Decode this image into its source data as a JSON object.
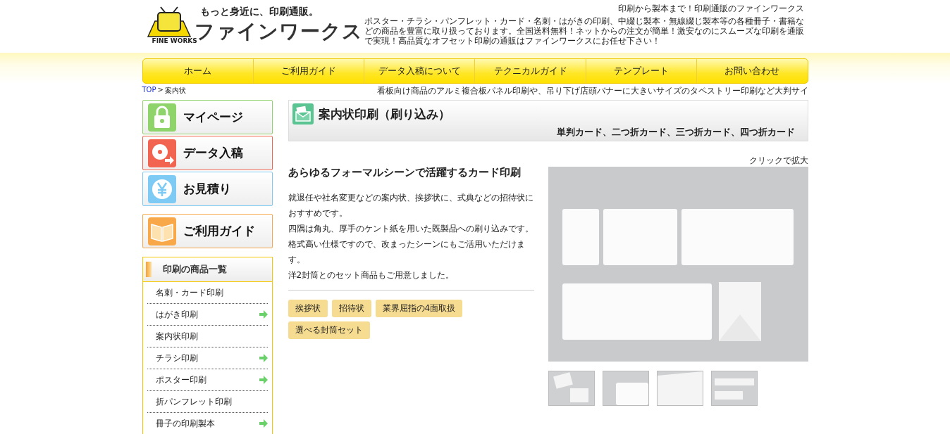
{
  "header": {
    "tagline": "もっと身近に、印刷通販。",
    "logo_text": "ファインワークス",
    "logo_badge": "FINE WORKS",
    "headline": "印刷から製本まで！印刷通販のファインワークス",
    "description": "ポスター・チラシ・パンフレット・カード・名刺・はがきの印刷、中綴じ製本・無線綴じ製本等の各種冊子・書籍などの商品を豊富に取り扱っております。全国送料無料！ネットからの注文が簡単！激安なのにスムーズな印刷を通販で実現！高品質なオフセット印刷の通販はファインワークスにお任せ下さい！"
  },
  "nav": [
    "ホーム",
    "ご利用ガイド",
    "データ入稿について",
    "テクニカルガイド",
    "テンプレート",
    "お問い合わせ"
  ],
  "breadcrumb": {
    "link": "TOP",
    "separator": ">",
    "current": "案内状"
  },
  "ticker": "看板向け商品のアルミ複合板パネル印刷や、吊り下げ店頭バナーに大きいサイズのタペストリー印刷など大判サイ",
  "sidebar": {
    "buttons": [
      {
        "label": "マイページ",
        "kind": "lock",
        "color": "#8fd46a"
      },
      {
        "label": "データ入稿",
        "kind": "disc",
        "color": "#f26450"
      },
      {
        "label": "お見積り",
        "kind": "yen",
        "color": "#7dcbf5"
      },
      {
        "label": "ご利用ガイド",
        "kind": "book",
        "color": "#f8a848"
      }
    ],
    "product_list": {
      "title": "印刷の商品一覧",
      "items": [
        {
          "label": "名刺・カード印刷",
          "has_submenu": false
        },
        {
          "label": "はがき印刷",
          "has_submenu": true
        },
        {
          "label": "案内状印刷",
          "has_submenu": false
        },
        {
          "label": "チラシ印刷",
          "has_submenu": true
        },
        {
          "label": "ポスター印刷",
          "has_submenu": true
        },
        {
          "label": "折パンフレット印刷",
          "has_submenu": false
        },
        {
          "label": "冊子の印刷製本",
          "has_submenu": true
        }
      ]
    }
  },
  "product": {
    "title": "案内状印刷（刷り込み）",
    "subtitle": "単判カード、二つ折カード、三つ折カード、四つ折カード",
    "heading": "あらゆるフォーマルシーンで活躍するカード印刷",
    "paragraphs": [
      "就退任や社名変更などの案内状、挨拶状に、式典などの招待状におすすめです。",
      "四隅は角丸、厚手のケント紙を用いた既製品への刷り込みです。",
      "格式高い仕様ですので、改まったシーンにもご活用いただけます。",
      "洋2封筒とのセット商品もご用意しました。"
    ],
    "tags": [
      "挨拶状",
      "招待状",
      "業界屈指の4面取扱",
      "選べる封筒セット"
    ],
    "zoom_hint": "クリックで拡大",
    "image": {
      "kind": "picture"
    },
    "thumbnails": [
      {
        "kind": "picture"
      },
      {
        "kind": "picture"
      },
      {
        "kind": "picture"
      },
      {
        "kind": "picture"
      }
    ]
  }
}
